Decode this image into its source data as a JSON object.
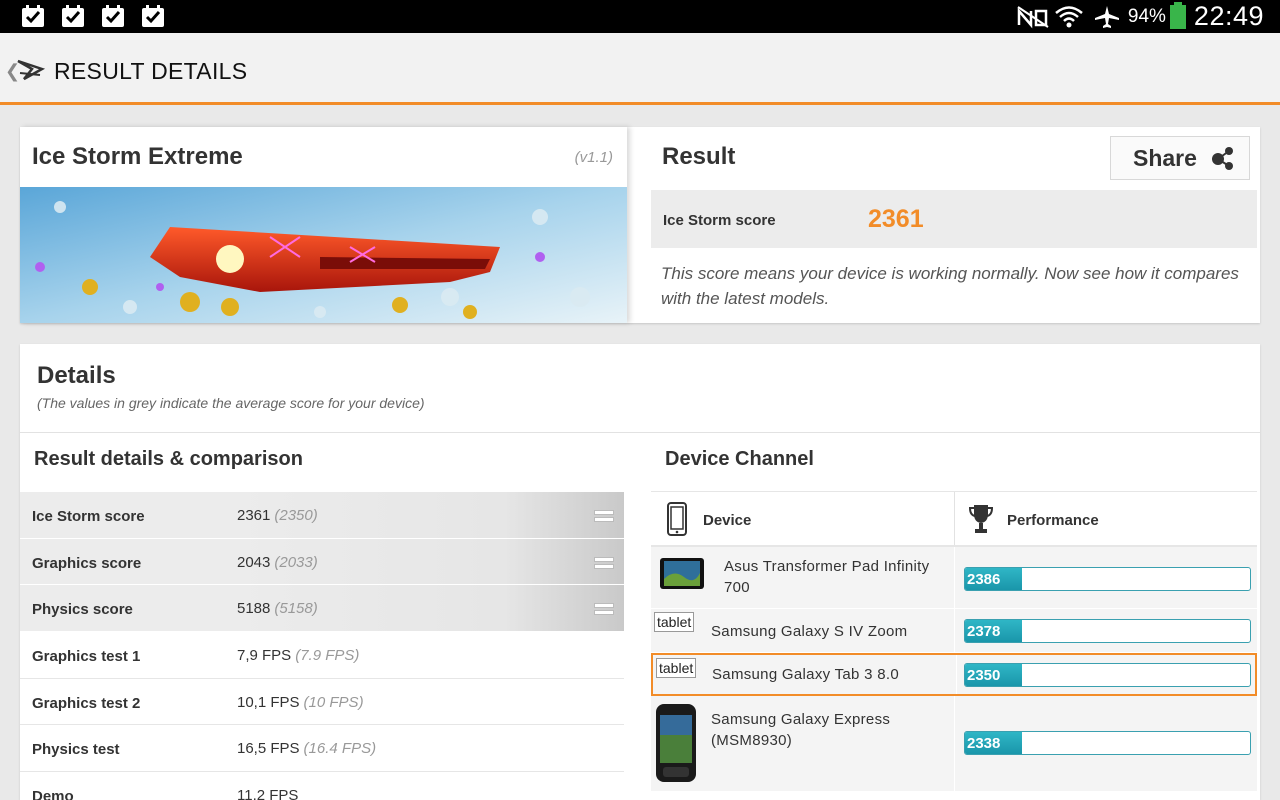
{
  "status_bar": {
    "notifications": [
      "check-notification-icon",
      "check-notification-icon",
      "check-notification-icon",
      "check-notification-icon"
    ],
    "battery_percent": "94%",
    "time": "22:49"
  },
  "header": {
    "title": "RESULT DETAILS",
    "back_glyph": "❮"
  },
  "benchmark": {
    "name": "Ice Storm Extreme",
    "version": "(v1.1)"
  },
  "result": {
    "title": "Result",
    "share_label": "Share",
    "score_label": "Ice Storm score",
    "score_value": "2361",
    "message": "This score means your device is working normally. Now see how it compares with the latest models."
  },
  "details": {
    "title": "Details",
    "subtitle": "(The values in grey indicate the average score for your device)",
    "left_title": "Result details & comparison",
    "right_title": "Device Channel",
    "rows": [
      {
        "label": "Ice Storm score",
        "value": "2361",
        "avg": "(2350)"
      },
      {
        "label": "Graphics score",
        "value": "2043",
        "avg": "(2033)"
      },
      {
        "label": "Physics score",
        "value": "5188",
        "avg": "(5158)"
      },
      {
        "label": "Graphics test 1",
        "value": "7,9 FPS",
        "avg": "(7.9 FPS)"
      },
      {
        "label": "Graphics test 2",
        "value": "10,1 FPS",
        "avg": "(10 FPS)"
      },
      {
        "label": "Physics test",
        "value": "16,5 FPS",
        "avg": "(16.4 FPS)"
      },
      {
        "label": "Demo",
        "value": "11,2 FPS",
        "avg": ""
      }
    ],
    "device_header": {
      "device": "Device",
      "performance": "Performance"
    },
    "devices": [
      {
        "name_line1": "Asus Transformer Pad Infinity",
        "name_line2": "700",
        "score": "2386",
        "thumb": "tablet-image"
      },
      {
        "name_line1": "Samsung Galaxy S IV Zoom",
        "name_line2": "",
        "score": "2378",
        "thumb_text": "tablet"
      },
      {
        "name_line1": "Samsung Galaxy Tab 3 8.0",
        "name_line2": "",
        "score": "2350",
        "thumb_text": "tablet"
      },
      {
        "name_line1": "Samsung Galaxy Express",
        "name_line2": "(MSM8930)",
        "score": "2338",
        "thumb": "phone-image"
      }
    ]
  },
  "colors": {
    "accent": "#f28c28",
    "bar": "#1fa6b8"
  }
}
